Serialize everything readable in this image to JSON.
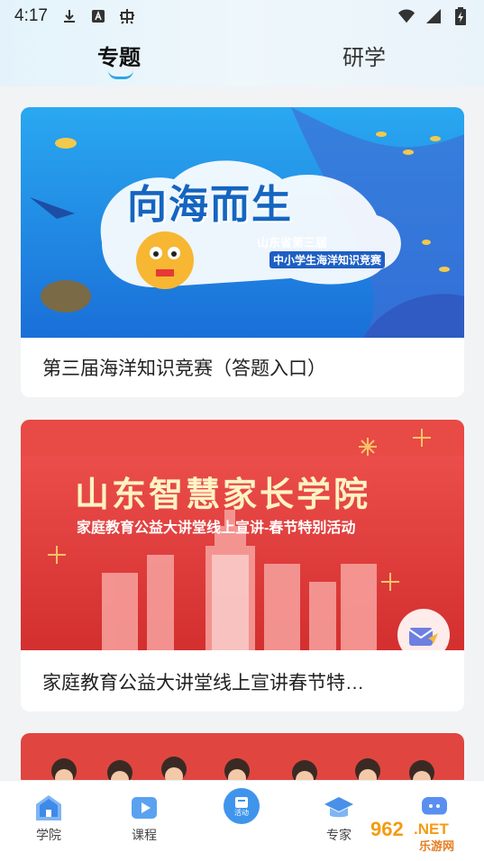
{
  "status_bar": {
    "time": "4:17",
    "left_icons": [
      "download-icon",
      "a-icon",
      "bug-icon"
    ],
    "right_icons": [
      "wifi-icon",
      "signal-icon",
      "battery-icon"
    ]
  },
  "tabs": [
    {
      "label": "专题",
      "active": true
    },
    {
      "label": "研学",
      "active": false
    }
  ],
  "cards": [
    {
      "title": "第三届海洋知识竞赛（答题入口）",
      "banner": {
        "main_text": "向海而生",
        "sub_line1": "山东省第三届",
        "sub_line2": "中小学生海洋知识竞赛"
      }
    },
    {
      "title": "家庭教育公益大讲堂线上宣讲春节特…",
      "banner": {
        "main_text": "山东智慧家长学院",
        "sub_text": "家庭教育公益大讲堂线上宣讲-春节特别活动"
      }
    },
    {
      "title": ""
    }
  ],
  "bottom_nav": [
    {
      "label": "学院",
      "icon": "school-icon"
    },
    {
      "label": "课程",
      "icon": "play-icon"
    },
    {
      "label": "活动",
      "icon": "activity-icon"
    },
    {
      "label": "专家",
      "icon": "graduation-cap-icon"
    },
    {
      "label": "",
      "icon": "chat-icon"
    }
  ],
  "watermark": {
    "line1": "962.NET",
    "line2": "乐游网"
  },
  "colors": {
    "accent": "#2aa6e8",
    "banner1_bg": "#1e88e5",
    "banner2_bg": "#e53935"
  }
}
